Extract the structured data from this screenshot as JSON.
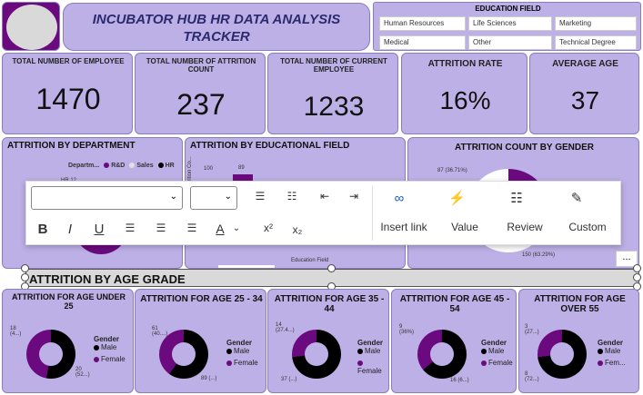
{
  "header": {
    "title_line1": "INCUBATOR HUB HR DATA ANALYSIS",
    "title_line2": "TRACKER"
  },
  "education_filter": {
    "title": "EDUCATION FIELD",
    "options": [
      "Human Resources",
      "Life Sciences",
      "Marketing",
      "Medical",
      "Other",
      "Technical Degree"
    ]
  },
  "kpis": [
    {
      "label": "TOTAL NUMBER OF EMPLOYEE",
      "value": "1470"
    },
    {
      "label": "TOTAL NUMBER OF ATTRITION COUNT",
      "value": "237"
    },
    {
      "label": "TOTAL NUMBER OF CURRENT EMPLOYEE",
      "value": "1233"
    },
    {
      "label": "ATTRITION RATE",
      "value": "16%"
    },
    {
      "label": "AVERAGE AGE",
      "value": "37"
    }
  ],
  "sections": {
    "by_department": "ATTRITION BY DEPARTMENT",
    "by_education": "ATTRITION BY EDUCATIONAL FIELD",
    "by_gender": "ATTRITION COUNT BY GENDER",
    "by_age_grade": "ATTRITION BY AGE GRADE"
  },
  "department_legend": {
    "label": "Departm...",
    "items": [
      "R&D",
      "Sales",
      "HR"
    ],
    "hr_note": "HR 12 ..."
  },
  "education_chart": {
    "y_label": "Attrition Co...",
    "tick": "100",
    "bar_label": "89",
    "x_label": "Education Field"
  },
  "gender_chart": {
    "label_female": "87 (36.71%)",
    "label_male": "150 (63.29%)"
  },
  "toolbar": {
    "insert_link": "Insert link",
    "value": "Value",
    "review": "Review",
    "custom": "Custom",
    "bold": "B",
    "italic": "I",
    "underline": "U",
    "superscript": "x²",
    "subscript": "x₂",
    "font_color": "A"
  },
  "more_options": "...",
  "age_charts": [
    {
      "title": "ATTRITION FOR AGE UNDER 25",
      "top_label": "18\n(4...)",
      "bottom_label": "20\n(52...)",
      "female_share": 0.47
    },
    {
      "title": "ATTRITION FOR AGE 25 - 34",
      "top_label": "61\n(40....)",
      "bottom_label": "89 (...)",
      "female_share": 0.4
    },
    {
      "title": "ATTRITION FOR AGE 35 - 44",
      "top_label": "14\n(27.4...)",
      "bottom_label": "37 (...)",
      "female_share": 0.27
    },
    {
      "title": "ATTRITION FOR AGE 45 - 54",
      "top_label": "9\n(36%)",
      "bottom_label": "16 (6...)",
      "female_share": 0.36
    },
    {
      "title": "ATTRITION FOR AGE OVER 55",
      "top_label": "3\n(27...)",
      "bottom_label": "8\n(72...)",
      "female_share": 0.27
    }
  ],
  "age_legend": {
    "title": "Gender",
    "male": "Male",
    "female": "Female",
    "female_short": "Fem..."
  },
  "colors": {
    "male": "#000000",
    "female": "#6a0a7e",
    "card": "#bdb0e6",
    "title": "#2b2a6e"
  }
}
